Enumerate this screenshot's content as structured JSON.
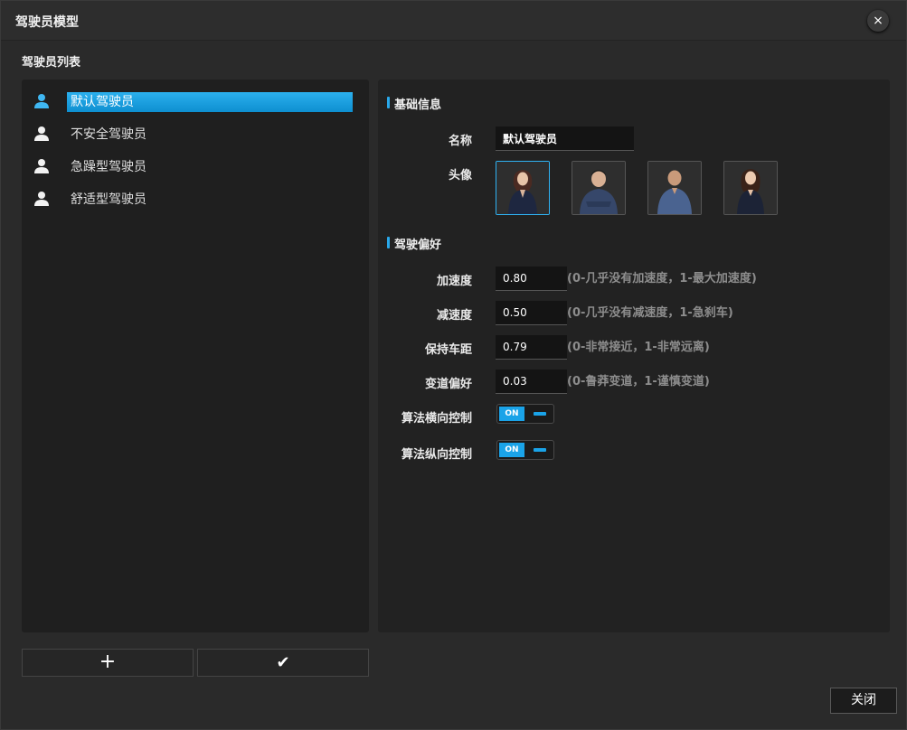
{
  "window": {
    "title": "驾驶员模型",
    "close_icon": "×"
  },
  "driver_list": {
    "title": "驾驶员列表",
    "items": [
      {
        "label": "默认驾驶员",
        "selected": true
      },
      {
        "label": "不安全驾驶员",
        "selected": false
      },
      {
        "label": "急躁型驾驶员",
        "selected": false
      },
      {
        "label": "舒适型驾驶员",
        "selected": false
      }
    ],
    "add_icon": "+",
    "confirm_icon": "✔"
  },
  "basic_info": {
    "title": "基础信息",
    "name_label": "名称",
    "name_value": "默认驾驶员",
    "avatar_label": "头像",
    "avatars": [
      "female-avatar-1",
      "male-avatar-1",
      "male-avatar-2",
      "female-avatar-2"
    ],
    "selected_avatar": 0
  },
  "preferences": {
    "title": "驾驶偏好",
    "params": [
      {
        "label": "加速度",
        "value": "0.80",
        "hint": "(0-几乎没有加速度，1-最大加速度)"
      },
      {
        "label": "减速度",
        "value": "0.50",
        "hint": "(0-几乎没有减速度，1-急刹车)"
      },
      {
        "label": "保持车距",
        "value": "0.79",
        "hint": "(0-非常接近，1-非常远离)"
      },
      {
        "label": "变道偏好",
        "value": "0.03",
        "hint": "(0-鲁莽变道，1-谨慎变道)"
      }
    ],
    "toggles": [
      {
        "label": "算法横向控制",
        "state": "ON"
      },
      {
        "label": "算法纵向控制",
        "state": "ON"
      }
    ]
  },
  "footer": {
    "close_label": "关闭"
  },
  "colors": {
    "accent": "#29a8ea",
    "panel": "#1f1f1f",
    "background": "#2a2a2a"
  }
}
